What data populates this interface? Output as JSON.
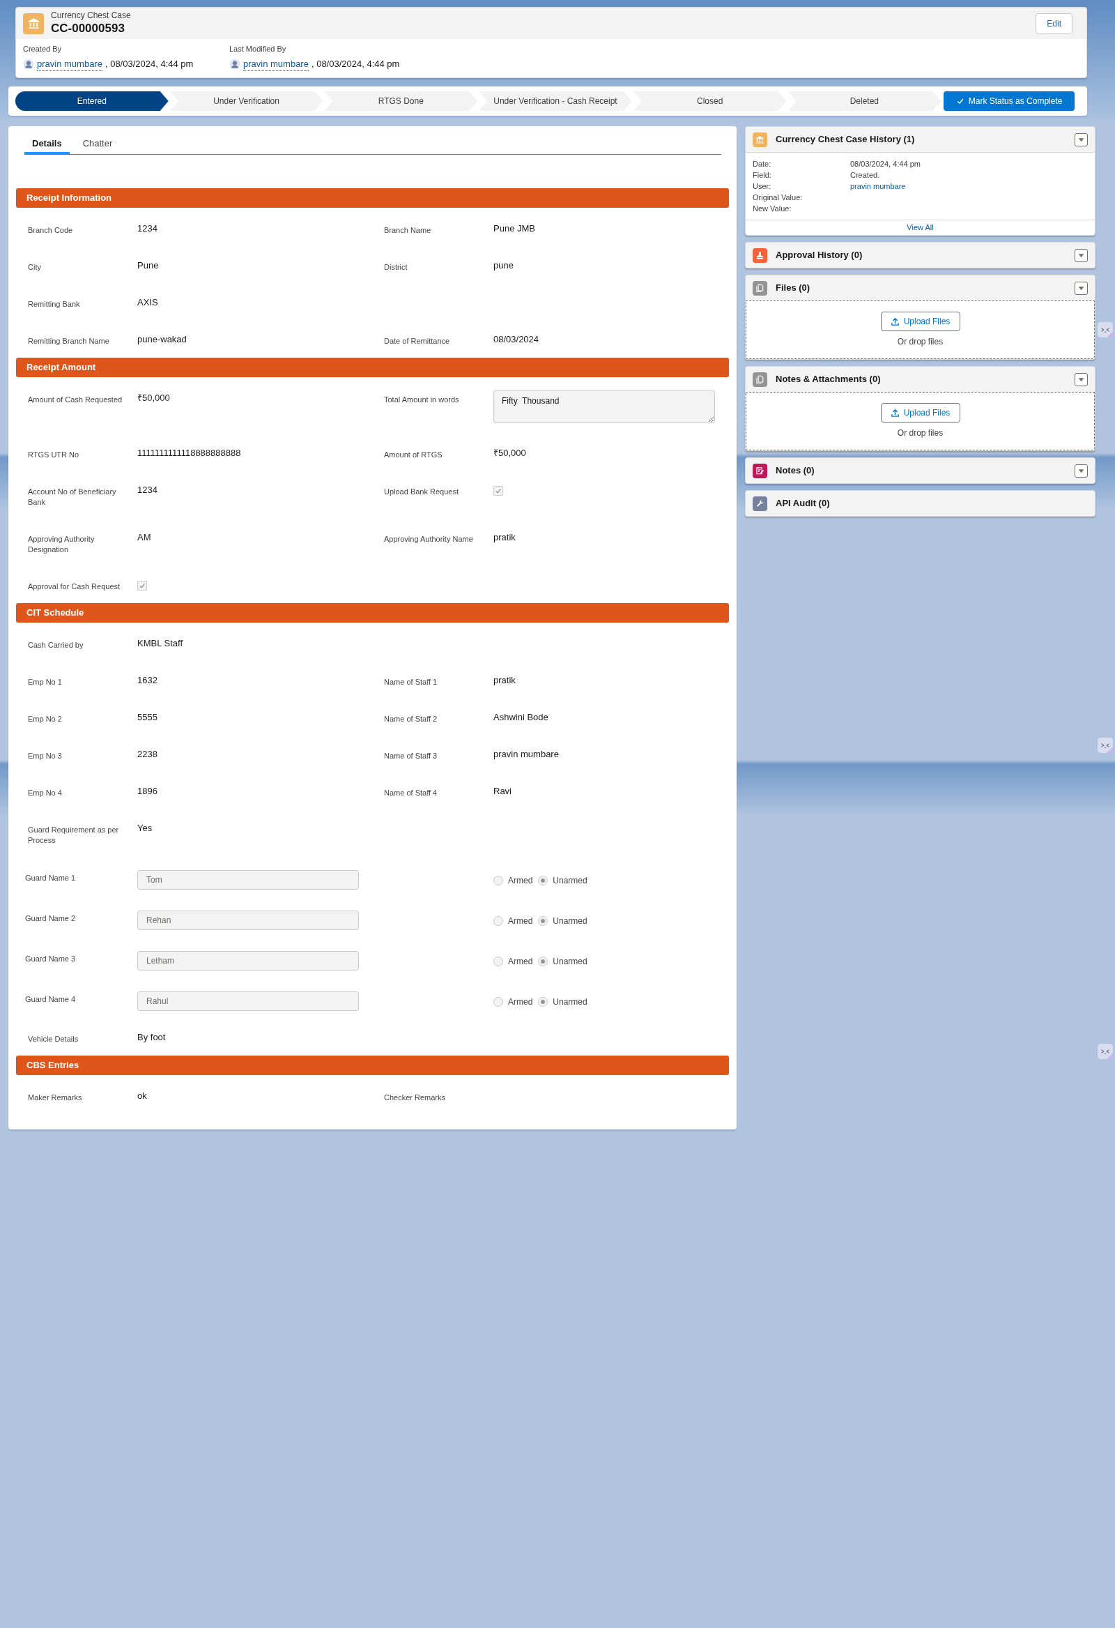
{
  "record": {
    "object_type": "Currency Chest Case",
    "name": "CC-00000593",
    "edit_label": "Edit",
    "meta": [
      {
        "label": "Created By",
        "user": "pravin mumbare",
        "date": ", 08/03/2024, 4:44 pm"
      },
      {
        "label": "Last Modified By",
        "user": "pravin mumbare",
        "date": ", 08/03/2024, 4:44 pm"
      }
    ]
  },
  "path": {
    "stages": [
      {
        "label": "Entered",
        "selected": true
      },
      {
        "label": "Under Verification",
        "selected": false
      },
      {
        "label": "RTGS Done",
        "selected": false
      },
      {
        "label": "Under Verification - Cash Receipt",
        "selected": false
      },
      {
        "label": "Closed",
        "selected": false
      },
      {
        "label": "Deleted",
        "selected": false
      }
    ],
    "action": "Mark Status as Complete"
  },
  "tabs": [
    {
      "label": "Details",
      "selected": true
    },
    {
      "label": "Chatter",
      "selected": false
    }
  ],
  "sections": [
    {
      "title": "Receipt Information",
      "rows": [
        {
          "cells": [
            {
              "kind": "text",
              "label": "Branch Code",
              "value": "1234"
            },
            {
              "kind": "text",
              "label": "Branch Name",
              "value": "Pune JMB"
            }
          ]
        },
        {
          "cells": [
            {
              "kind": "text",
              "label": "City",
              "value": "Pune"
            },
            {
              "kind": "text",
              "label": "District",
              "value": "pune"
            }
          ]
        },
        {
          "cells": [
            {
              "kind": "text",
              "label": "Remitting Bank",
              "value": "AXIS"
            }
          ]
        },
        {
          "cells": [
            {
              "kind": "text",
              "label": "Remitting Branch Name",
              "value": "pune-wakad"
            },
            {
              "kind": "text",
              "label": "Date of Remittance",
              "value": "08/03/2024"
            }
          ]
        }
      ]
    },
    {
      "title": "Receipt Amount",
      "rows": [
        {
          "cells": [
            {
              "kind": "text",
              "label": "Amount of Cash Requested",
              "value": "₹50,000"
            },
            {
              "kind": "textarea",
              "label": "Total Amount in words",
              "value": "Fifty  Thousand"
            }
          ]
        },
        {
          "cells": [
            {
              "kind": "text",
              "label": "RTGS UTR No",
              "value": "1111111111118888888888"
            },
            {
              "kind": "text",
              "label": "Amount of RTGS",
              "value": "₹50,000"
            }
          ]
        },
        {
          "cells": [
            {
              "kind": "text",
              "label": "Account No of Beneficiary Bank",
              "value": "1234"
            },
            {
              "kind": "checkbox",
              "label": "Upload Bank Request",
              "checked": true
            }
          ]
        },
        {
          "cells": [
            {
              "kind": "text",
              "label": "Approving Authority Designation",
              "value": "AM"
            },
            {
              "kind": "text",
              "label": "Approving Authority Name",
              "value": "pratik"
            }
          ]
        },
        {
          "cells": [
            {
              "kind": "checkbox",
              "label": "Approval for Cash Request",
              "checked": true
            }
          ]
        }
      ]
    },
    {
      "title": "CIT Schedule",
      "rows": [
        {
          "cells": [
            {
              "kind": "text",
              "label": "Cash Carried by",
              "value": "KMBL Staff"
            }
          ]
        },
        {
          "cells": [
            {
              "kind": "text",
              "label": "Emp No 1",
              "value": "1632"
            },
            {
              "kind": "text",
              "label": "Name of Staff 1",
              "value": "pratik"
            }
          ]
        },
        {
          "cells": [
            {
              "kind": "text",
              "label": "Emp No 2",
              "value": "5555"
            },
            {
              "kind": "text",
              "label": "Name of Staff 2",
              "value": "Ashwini Bode"
            }
          ]
        },
        {
          "cells": [
            {
              "kind": "text",
              "label": "Emp No 3",
              "value": "2238"
            },
            {
              "kind": "text",
              "label": "Name of Staff 3",
              "value": "pravin mumbare"
            }
          ]
        },
        {
          "cells": [
            {
              "kind": "text",
              "label": "Emp No 4",
              "value": "1896"
            },
            {
              "kind": "text",
              "label": "Name of Staff 4",
              "value": "Ravi"
            }
          ]
        },
        {
          "cells": [
            {
              "kind": "text",
              "label": "Guard Requirement as per Process",
              "value": "Yes"
            }
          ]
        },
        {
          "cells": [
            {
              "kind": "guard",
              "label": "Guard Name 1",
              "value": "Tom",
              "options": [
                {
                  "label": "Armed",
                  "selected": false
                },
                {
                  "label": "Unarmed",
                  "selected": true
                }
              ]
            }
          ]
        },
        {
          "cells": [
            {
              "kind": "guard",
              "label": "Guard Name 2",
              "value": "Rehan",
              "options": [
                {
                  "label": "Armed",
                  "selected": false
                },
                {
                  "label": "Unarmed",
                  "selected": true
                }
              ]
            }
          ]
        },
        {
          "cells": [
            {
              "kind": "guard",
              "label": "Guard Name 3",
              "value": "Letham",
              "options": [
                {
                  "label": "Armed",
                  "selected": false
                },
                {
                  "label": "Unarmed",
                  "selected": true
                }
              ]
            }
          ]
        },
        {
          "cells": [
            {
              "kind": "guard",
              "label": "Guard Name 4",
              "value": "Rahul",
              "options": [
                {
                  "label": "Armed",
                  "selected": false
                },
                {
                  "label": "Unarmed",
                  "selected": true
                }
              ]
            }
          ]
        },
        {
          "cells": [
            {
              "kind": "text",
              "label": "Vehicle Details",
              "value": "By foot"
            }
          ]
        }
      ]
    },
    {
      "title": "CBS Entries",
      "rows": [
        {
          "cells": [
            {
              "kind": "text",
              "label": "Maker Remarks",
              "value": "ok"
            },
            {
              "kind": "text",
              "label": "Checker Remarks"
            }
          ]
        }
      ]
    }
  ],
  "related": [
    {
      "kind": "history",
      "title": "Currency Chest Case History (1)",
      "color": "#f0b35f",
      "menu": true,
      "entries": [
        {
          "label": "Date:",
          "value": "08/03/2024, 4:44 pm",
          "link": false
        },
        {
          "label": "Field:",
          "value": "Created.",
          "link": false
        },
        {
          "label": "User:",
          "value": "pravin mumbare",
          "link": true
        },
        {
          "label": "Original Value:"
        },
        {
          "label": "New Value:"
        }
      ],
      "footer": "View All"
    },
    {
      "kind": "plain",
      "title": "Approval History (0)",
      "color": "#f4623a",
      "menu": true
    },
    {
      "kind": "upload",
      "title": "Files (0)",
      "color": "#939393",
      "menu": true,
      "button": "Upload Files",
      "hint": "Or drop files"
    },
    {
      "kind": "upload",
      "title": "Notes & Attachments (0)",
      "color": "#939393",
      "menu": true,
      "button": "Upload Files",
      "hint": "Or drop files"
    },
    {
      "kind": "plain",
      "title": "Notes (0)",
      "color": "#c2185b",
      "menu": true
    },
    {
      "kind": "plain",
      "title": "API Audit (0)",
      "color": "#76809c",
      "menu": false
    }
  ]
}
